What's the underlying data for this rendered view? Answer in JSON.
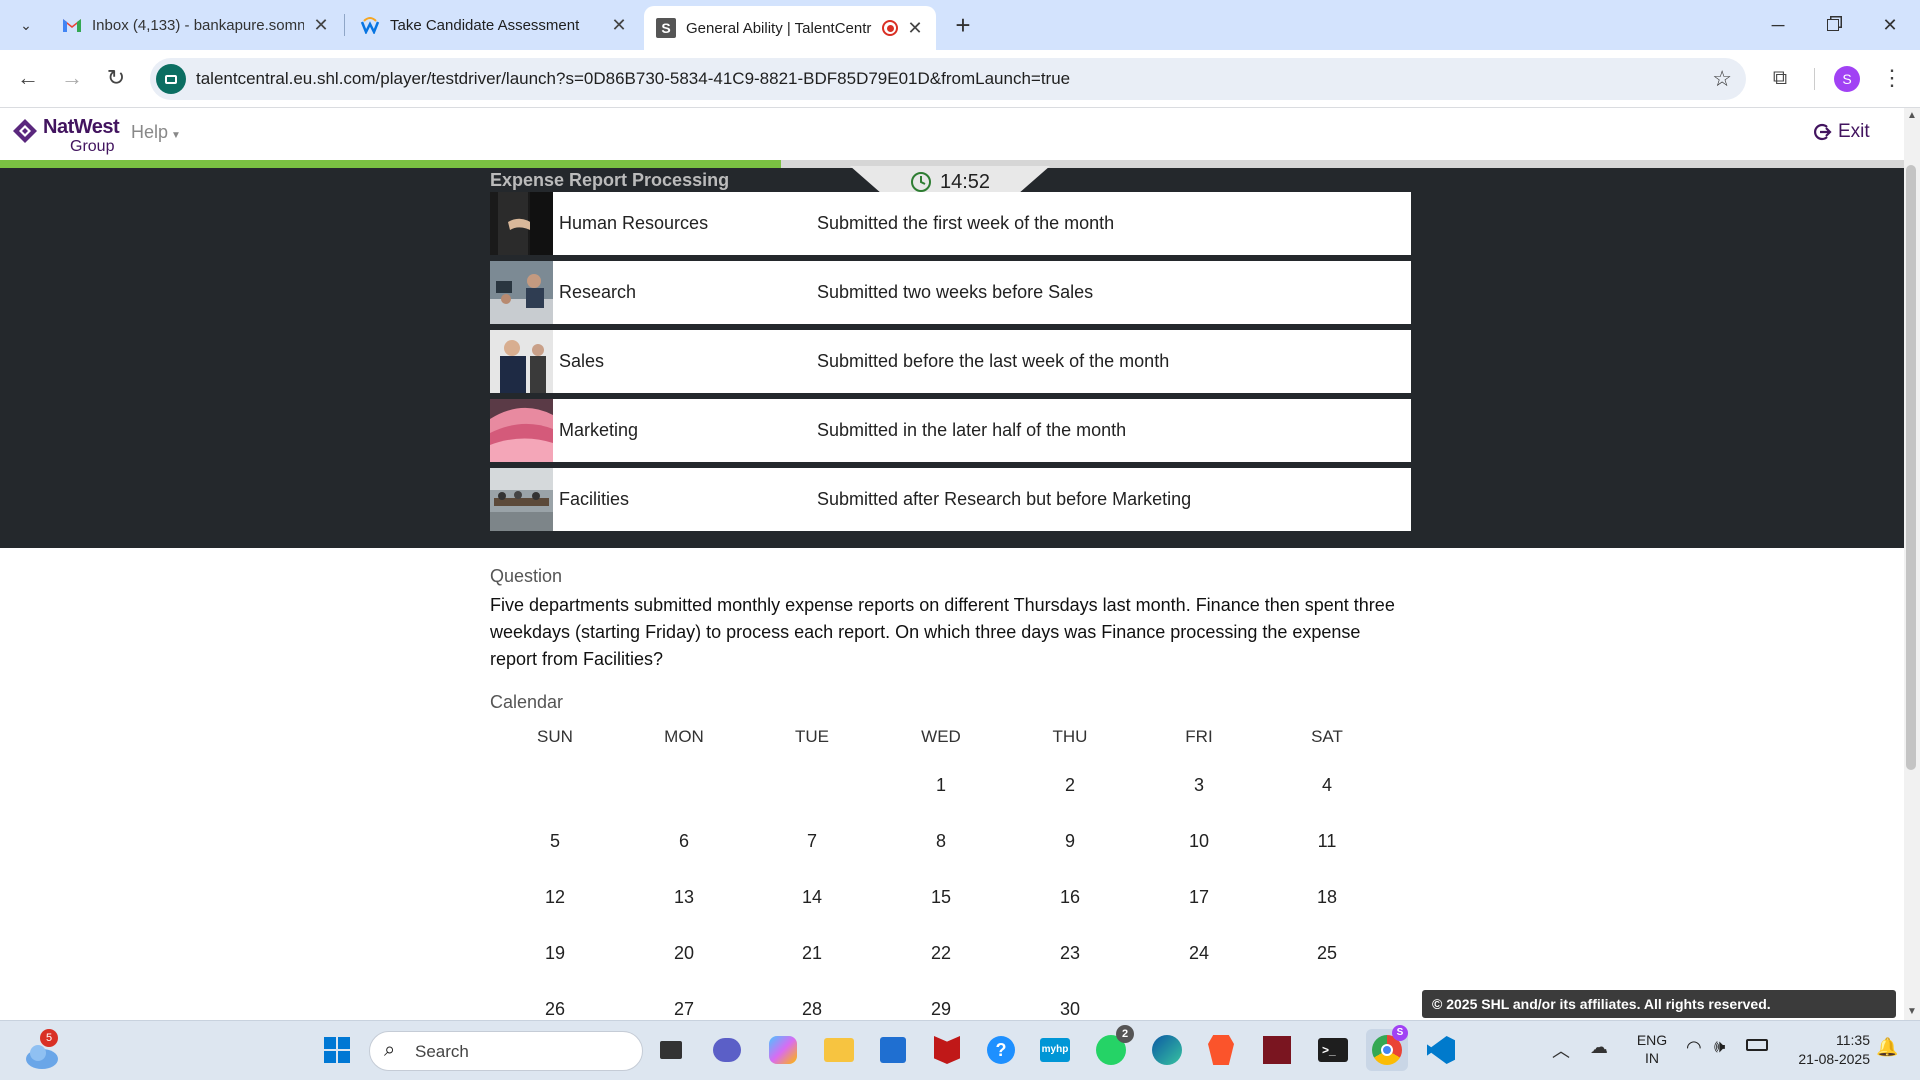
{
  "browser": {
    "tabs": [
      {
        "title": "Inbox (4,133) - bankapure.somn",
        "icon": "gmail-icon"
      },
      {
        "title": "Take Candidate Assessment",
        "icon": "workday-icon"
      },
      {
        "title": "General Ability | TalentCentr",
        "icon": "shl-icon",
        "recording": true
      }
    ],
    "new_tab": "+",
    "url": "talentcentral.eu.shl.com/player/testdriver/launch?s=0D86B730-5834-41C9-8821-BDF85D79E01D&fromLaunch=true",
    "profile_initial": "S"
  },
  "app": {
    "brand_main": "NatWest",
    "brand_sub": "Group",
    "help_label": "Help",
    "exit_label": "Exit",
    "timer": "14:52",
    "progress_fraction": 0.41
  },
  "table": {
    "title": "Expense Report Processing",
    "rows": [
      {
        "dept": "Human Resources",
        "desc": "Submitted the first week of the month"
      },
      {
        "dept": "Research",
        "desc": "Submitted two weeks before Sales"
      },
      {
        "dept": "Sales",
        "desc": "Submitted before the last week of the month"
      },
      {
        "dept": "Marketing",
        "desc": "Submitted in the later half of the month"
      },
      {
        "dept": "Facilities",
        "desc": "Submitted after Research but before Marketing"
      }
    ]
  },
  "question": {
    "label": "Question",
    "text": "Five departments submitted monthly expense reports on different Thursdays last month. Finance then spent three weekdays (starting Friday) to process each report. On which three days was Finance processing the expense report from Facilities?"
  },
  "calendar": {
    "label": "Calendar",
    "days_of_week": [
      "SUN",
      "MON",
      "TUE",
      "WED",
      "THU",
      "FRI",
      "SAT"
    ],
    "weeks": [
      [
        "",
        "",
        "",
        "1",
        "2",
        "3",
        "4"
      ],
      [
        "5",
        "6",
        "7",
        "8",
        "9",
        "10",
        "11"
      ],
      [
        "12",
        "13",
        "14",
        "15",
        "16",
        "17",
        "18"
      ],
      [
        "19",
        "20",
        "21",
        "22",
        "23",
        "24",
        "25"
      ],
      [
        "26",
        "27",
        "28",
        "29",
        "30",
        "",
        ""
      ]
    ]
  },
  "footer": {
    "copyright": "© 2025 SHL and/or its affiliates. All rights reserved."
  },
  "taskbar": {
    "weather_badge": "5",
    "search_placeholder": "Search",
    "whatsapp_badge": "2",
    "chrome_badge": "S",
    "lang_top": "ENG",
    "lang_bottom": "IN",
    "time": "11:35",
    "date": "21-08-2025"
  },
  "colors": {
    "tabstrip": "#d3e3fd",
    "dark_panel": "#24282c",
    "progress": "#7ac142",
    "natwest_purple": "#5a287d"
  }
}
